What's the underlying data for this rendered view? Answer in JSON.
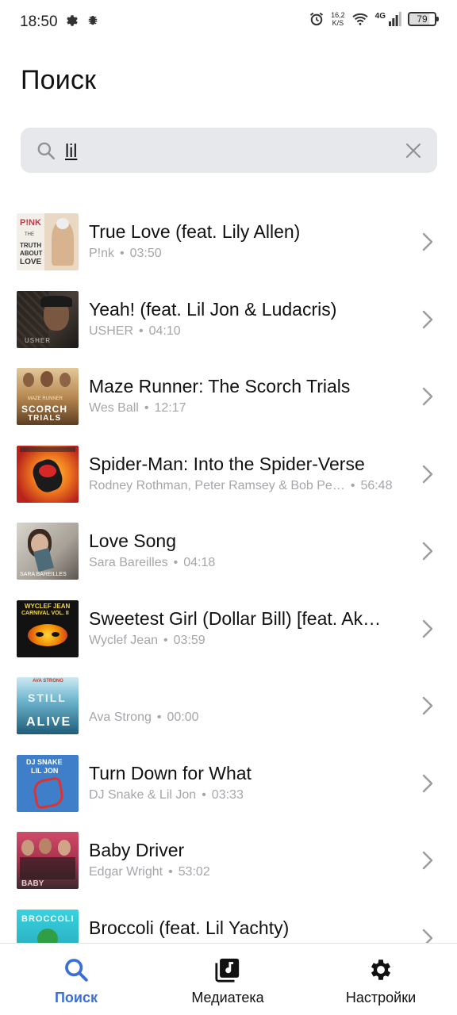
{
  "status_bar": {
    "time": "18:50",
    "net_speed_value": "16,2",
    "net_speed_unit": "K/S",
    "network": "4G",
    "battery": "79"
  },
  "header": {
    "title": "Поиск"
  },
  "search": {
    "value": "lil",
    "placeholder": ""
  },
  "results": [
    {
      "title": "True Love (feat. Lily Allen)",
      "artist": "P!nk",
      "duration": "03:50"
    },
    {
      "title": "Yeah! (feat. Lil Jon & Ludacris)",
      "artist": "USHER",
      "duration": "04:10"
    },
    {
      "title": "Maze Runner: The Scorch Trials",
      "artist": "Wes Ball",
      "duration": "12:17"
    },
    {
      "title": "Spider-Man: Into the Spider-Verse",
      "artist": "Rodney Rothman, Peter Ramsey & Bob Pe…",
      "duration": "56:48"
    },
    {
      "title": "Love Song",
      "artist": "Sara Bareilles",
      "duration": "04:18"
    },
    {
      "title": "Sweetest Girl (Dollar Bill) [feat. Ak…",
      "artist": "Wyclef Jean",
      "duration": "03:59"
    },
    {
      "title": "",
      "artist": "Ava Strong",
      "duration": "00:00"
    },
    {
      "title": "Turn Down for What",
      "artist": "DJ Snake & Lil Jon",
      "duration": "03:33"
    },
    {
      "title": "Baby Driver",
      "artist": "Edgar Wright",
      "duration": "53:02"
    },
    {
      "title": "Broccoli (feat. Lil Yachty)",
      "artist": "",
      "duration": ""
    }
  ],
  "covers": {
    "pink": {
      "line1": "P!NK",
      "line2": "THE",
      "line3": "TRUTH",
      "line4": "ABOUT",
      "line5": "LOVE"
    },
    "usher": {
      "line1": "USHER"
    },
    "maze": {
      "line1": "MAZE RUNNER",
      "line2": "SCORCH",
      "line3": "TRIALS"
    },
    "sara": {
      "line1": "SARA BAREILLES"
    },
    "wyclef": {
      "line1": "WYCLEF JEAN",
      "line2": "CARNIVAL VOL. II"
    },
    "ava": {
      "line1": "AVA STRONG",
      "line2": "STILL",
      "line3": "ALIVE"
    },
    "dj": {
      "line1": "DJ SNAKE",
      "line2": "LIL JON"
    },
    "baby": {
      "line1": "BABY"
    },
    "broccoli": {
      "line1": "BROCCOLI"
    }
  },
  "nav": {
    "search_label": "Поиск",
    "library_label": "Медиатека",
    "settings_label": "Настройки"
  },
  "colors": {
    "accent": "#3a6fd8",
    "subtitle": "#a4a6aa",
    "search_bg": "#e6e8ec"
  }
}
